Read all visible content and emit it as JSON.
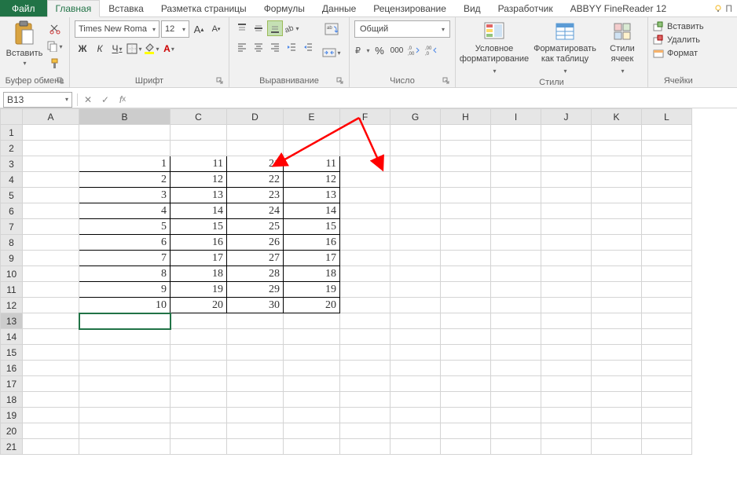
{
  "tabs": {
    "file": "Файл",
    "home": "Главная",
    "insert": "Вставка",
    "pagelayout": "Разметка страницы",
    "formulas": "Формулы",
    "data": "Данные",
    "review": "Рецензирование",
    "view": "Вид",
    "developer": "Разработчик",
    "abbyy": "ABBYY FineReader 12"
  },
  "ribbon": {
    "clipboard": {
      "paste": "Вставить",
      "label": "Буфер обмена"
    },
    "font": {
      "name": "Times New Roma",
      "size": "12",
      "label": "Шрифт",
      "bold": "Ж",
      "italic": "К",
      "underline": "Ч"
    },
    "alignment": {
      "label": "Выравнивание"
    },
    "number": {
      "format": "Общий",
      "label": "Число"
    },
    "styles": {
      "conditional": "Условное форматирование",
      "table": "Форматировать как таблицу",
      "cell": "Стили ячеек",
      "label": "Стили"
    },
    "cells": {
      "insert": "Вставить",
      "delete": "Удалить",
      "format": "Формат",
      "label": "Ячейки"
    }
  },
  "namebox": "B13",
  "columns": [
    "A",
    "B",
    "C",
    "D",
    "E",
    "F",
    "G",
    "H",
    "I",
    "J",
    "K",
    "L"
  ],
  "row_count": 21,
  "data_rows": [
    {
      "r": 3,
      "B": "1",
      "C": "11",
      "D": "21",
      "E": "11"
    },
    {
      "r": 4,
      "B": "2",
      "C": "12",
      "D": "22",
      "E": "12"
    },
    {
      "r": 5,
      "B": "3",
      "C": "13",
      "D": "23",
      "E": "13"
    },
    {
      "r": 6,
      "B": "4",
      "C": "14",
      "D": "24",
      "E": "14"
    },
    {
      "r": 7,
      "B": "5",
      "C": "15",
      "D": "25",
      "E": "15"
    },
    {
      "r": 8,
      "B": "6",
      "C": "16",
      "D": "26",
      "E": "16"
    },
    {
      "r": 9,
      "B": "7",
      "C": "17",
      "D": "27",
      "E": "17"
    },
    {
      "r": 10,
      "B": "8",
      "C": "18",
      "D": "28",
      "E": "18"
    },
    {
      "r": 11,
      "B": "9",
      "C": "19",
      "D": "29",
      "E": "19"
    },
    {
      "r": 12,
      "B": "10",
      "C": "20",
      "D": "30",
      "E": "20"
    }
  ],
  "selected_cell": {
    "row": 13,
    "col": "B"
  }
}
